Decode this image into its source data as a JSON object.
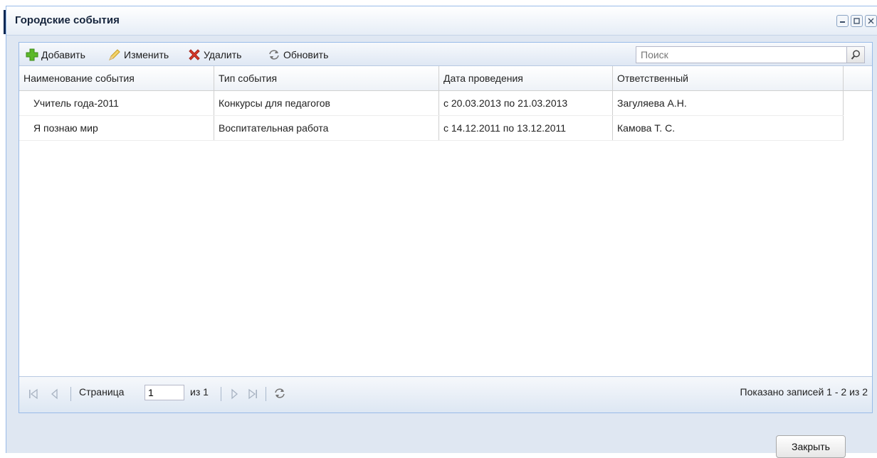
{
  "window": {
    "title": "Городские события",
    "controls": [
      "minimize-icon",
      "maximize-icon",
      "close-icon"
    ]
  },
  "toolbar": {
    "add_label": "Добавить",
    "edit_label": "Изменить",
    "delete_label": "Удалить",
    "refresh_label": "Обновить",
    "search_placeholder": "Поиск"
  },
  "table": {
    "columns": [
      "Наименование события",
      "Тип события",
      "Дата проведения",
      "Ответственный"
    ],
    "rows": [
      [
        "Учитель года-2011",
        "Конкурсы для педагогов",
        "с 20.03.2013 по 21.03.2013",
        "Загуляева А.Н."
      ],
      [
        "Я познаю мир",
        "Воспитательная работа",
        "с 14.12.2011 по 13.12.2011",
        "Камова Т. С."
      ]
    ]
  },
  "pager": {
    "page_label": "Страница",
    "page_value": "1",
    "of_label": "из 1",
    "summary": "Показано записей 1 - 2 из 2"
  },
  "footer": {
    "close_label": "Закрыть"
  },
  "colors": {
    "window_bg": "#dfe7f2",
    "border": "#99bbe8",
    "add_icon": "#5cb82a",
    "delete_icon": "#d9382a"
  }
}
